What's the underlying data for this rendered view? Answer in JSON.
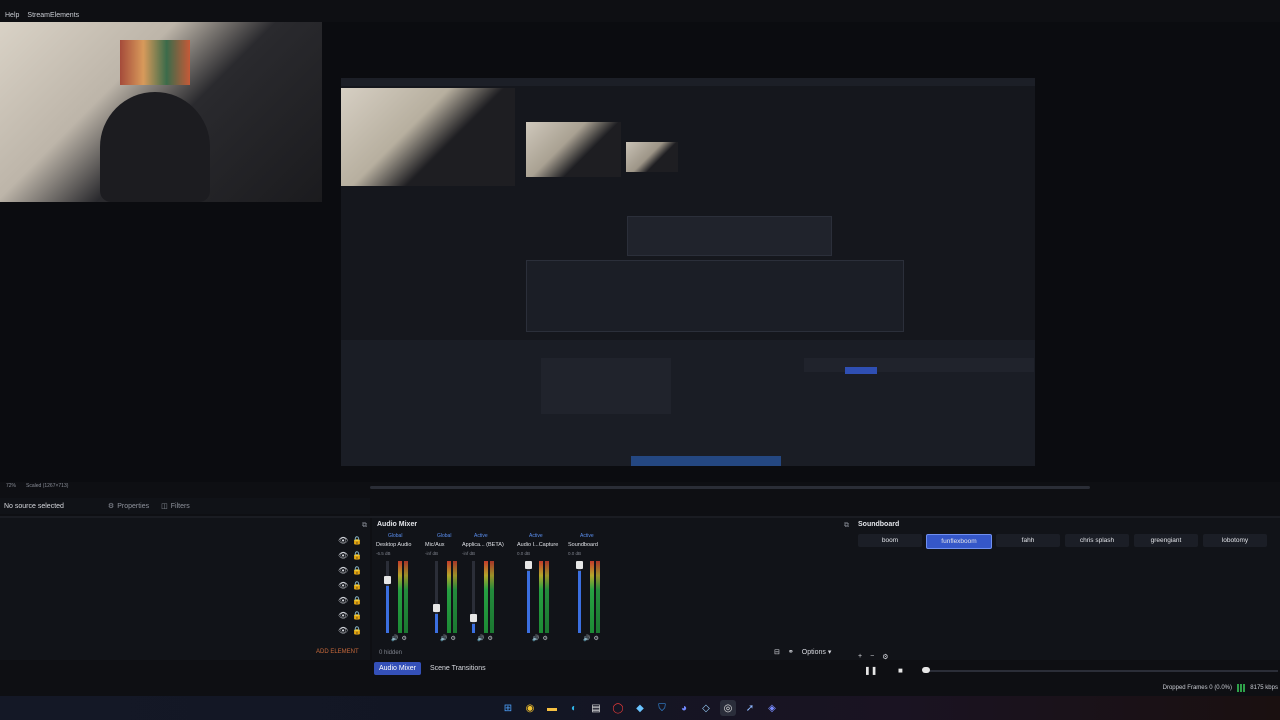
{
  "menu": [
    "Help",
    "StreamElements"
  ],
  "zoom_row": [
    "72%",
    "Scaled (1267×713)"
  ],
  "properties_bar": {
    "status": "No source selected",
    "properties_label": "Properties",
    "filters_label": "Filters"
  },
  "sources": {
    "add_element_label": "ADD ELEMENT",
    "rows": 7
  },
  "audio_mixer": {
    "title": "Audio Mixer",
    "hidden_label": "0 hidden",
    "options_label": "Options",
    "channels": [
      {
        "badge": "Global",
        "name": "Desktop Audio",
        "db": "-6.5 dB",
        "level": 0.75
      },
      {
        "badge": "Global",
        "name": "Mic/Aux",
        "db": "-inf dB",
        "level": 0.3
      },
      {
        "badge": "Active",
        "name": "Applica... (BETA)",
        "db": "-inf dB",
        "level": 0.15
      },
      {
        "badge": "Active",
        "name": "Audio I...Capture",
        "db": "0.0 dB",
        "level": 1.0
      },
      {
        "badge": "Active",
        "name": "Soundboard",
        "db": "0.0 dB",
        "level": 1.0
      }
    ]
  },
  "bottom_tabs": [
    {
      "label": "Audio Mixer",
      "active": true
    },
    {
      "label": "Scene Transitions",
      "active": false
    }
  ],
  "soundboard": {
    "title": "Soundboard",
    "buttons": [
      {
        "label": "boom",
        "selected": false
      },
      {
        "label": "funflexboom",
        "selected": true
      },
      {
        "label": "fahh",
        "selected": false
      },
      {
        "label": "chris splash",
        "selected": false
      },
      {
        "label": "greengiant",
        "selected": false
      },
      {
        "label": "lobotomy",
        "selected": false
      }
    ]
  },
  "status": {
    "dropped": "Dropped Frames 0 (0.0%)",
    "bitrate": "8175 kbps"
  },
  "colors": {
    "accent": "#3557c9",
    "add_element": "#c96a3b",
    "meter_green": "#26a042"
  },
  "taskbar_icons": [
    "windows-start-icon",
    "chrome-icon",
    "file-explorer-icon",
    "edge-icon",
    "notepad-icon",
    "opera-icon",
    "app-icon",
    "shield-icon",
    "discord-icon",
    "app-icon-2",
    "obs-icon",
    "app-icon-3",
    "app-icon-4"
  ]
}
